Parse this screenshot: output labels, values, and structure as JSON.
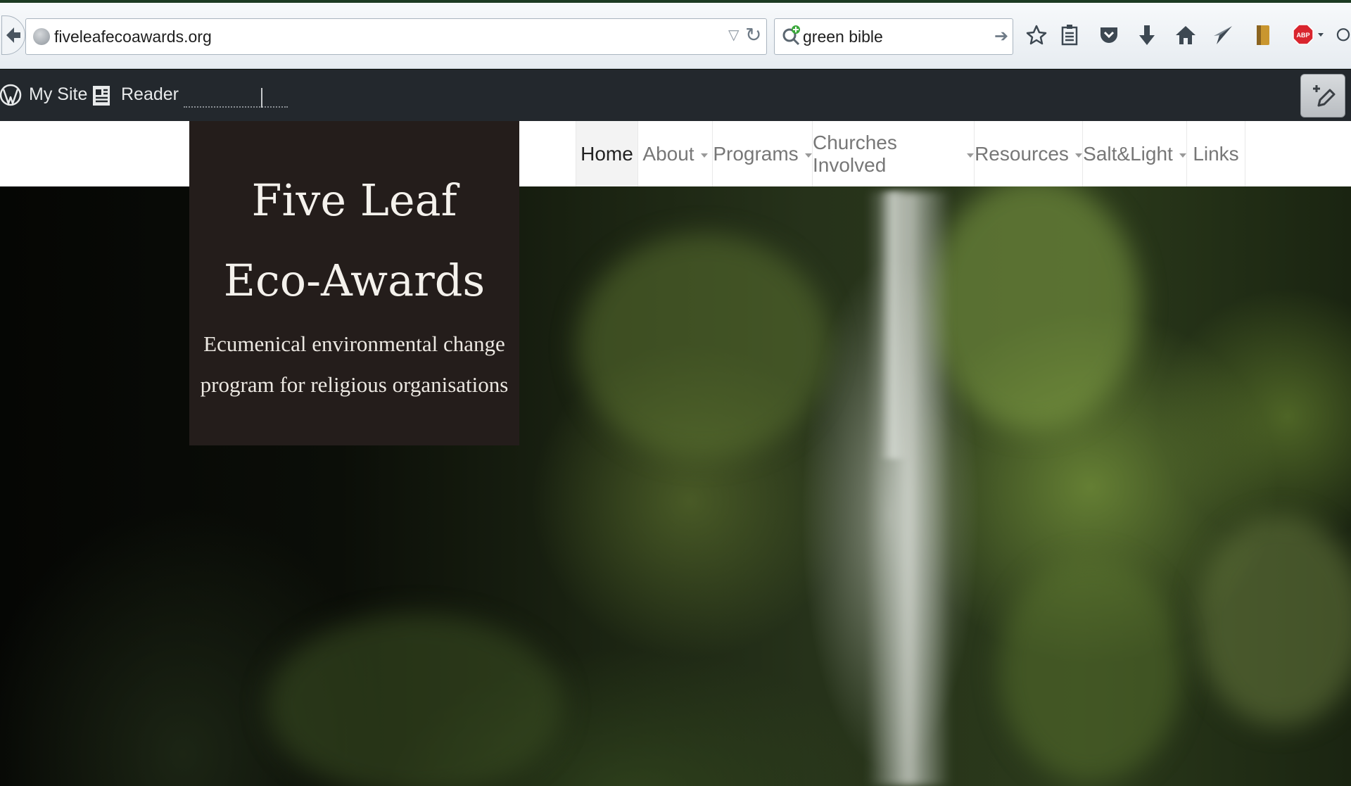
{
  "browser": {
    "url": "fiveleafecoawards.org",
    "search_query": "green bible",
    "toolbar_icons": [
      "bookmark-star-icon",
      "reading-list-icon",
      "pocket-icon",
      "download-icon",
      "home-icon",
      "send-icon",
      "bookmark-tab-icon",
      "adblock-icon",
      "chat-icon"
    ],
    "adblock_label": "ABP"
  },
  "wp_admin_bar": {
    "my_site": "My Site",
    "reader": "Reader"
  },
  "site": {
    "nav": [
      "Home",
      "About",
      "Programs",
      "Churches Involved",
      "Resources",
      "Salt&Light",
      "Links"
    ],
    "active_nav": "Home",
    "title_line1": "Five Leaf",
    "title_line2": "Eco-Awards",
    "tagline_line1": "Ecumenical environmental change",
    "tagline_line2": "program for religious organisations"
  },
  "colors": {
    "brand_box": "#241d1b",
    "wp_bar": "#23282d",
    "adblock_red": "#d9252e"
  }
}
